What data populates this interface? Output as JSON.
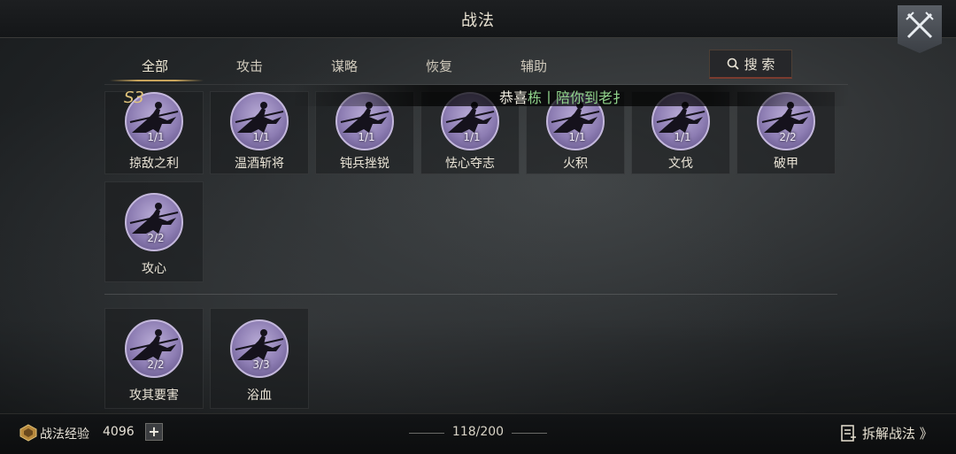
{
  "header": {
    "title": "战法"
  },
  "tabs": [
    {
      "label": "全部",
      "active": true
    },
    {
      "label": "攻击",
      "active": false
    },
    {
      "label": "谋略",
      "active": false
    },
    {
      "label": "恢复",
      "active": false
    },
    {
      "label": "辅助",
      "active": false
    }
  ],
  "search": {
    "label": "搜 索"
  },
  "grade_label": "S3",
  "marquee": {
    "prefix": "恭喜",
    "name": "栋丨陪你到老扌"
  },
  "section1": [
    {
      "name": "掠敌之利",
      "count": "1/1"
    },
    {
      "name": "温酒斩将",
      "count": "1/1"
    },
    {
      "name": "钝兵挫锐",
      "count": "1/1"
    },
    {
      "name": "怯心夺志",
      "count": "1/1"
    },
    {
      "name": "火积",
      "count": "1/1"
    },
    {
      "name": "文伐",
      "count": "1/1"
    },
    {
      "name": "破甲",
      "count": "2/2"
    },
    {
      "name": "攻心",
      "count": "2/2"
    }
  ],
  "section2": [
    {
      "name": "攻其要害",
      "count": "2/2"
    },
    {
      "name": "浴血",
      "count": "3/3"
    }
  ],
  "footer": {
    "exp_label": "战法经验",
    "exp_value": "4096",
    "plus": "+",
    "capacity": "118/200",
    "disassemble_label": "拆解战法 》"
  },
  "colors": {
    "accent_gold": "#c9a55c",
    "icon_purple": "#8d7db3",
    "marquee_name": "#8fd18a"
  },
  "icons": {
    "close": "crossed-swords-icon",
    "search": "search-icon",
    "exp": "exp-badge-icon",
    "disassemble": "disassemble-icon"
  }
}
